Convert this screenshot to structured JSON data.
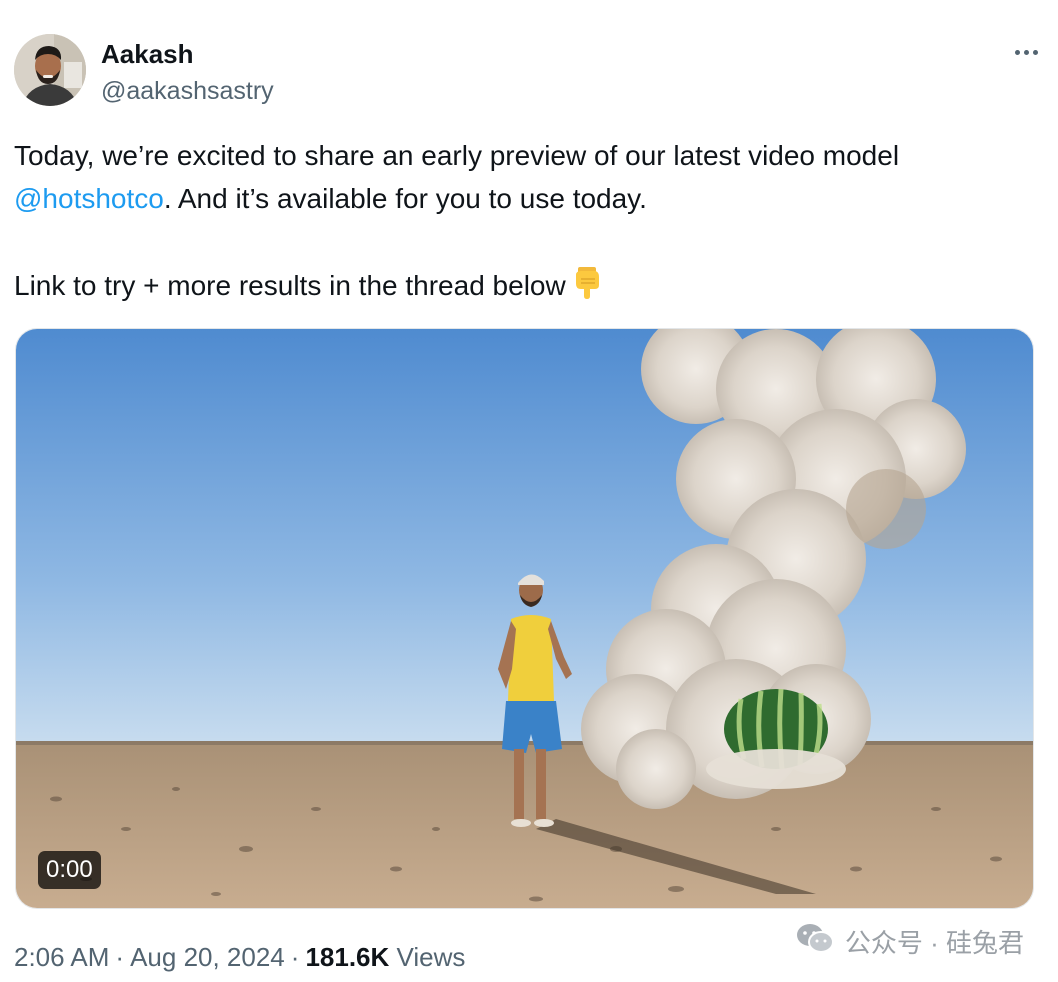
{
  "author": {
    "display_name": "Aakash",
    "handle": "@aakashsastry",
    "avatar_icon": "profile-photo"
  },
  "menu": {
    "icon": "more-horizontal-icon"
  },
  "tweet": {
    "line1": "Today, we’re excited to share an early preview of our latest video model",
    "mention": "@hotshotco",
    "line2_rest": ". And it’s available for you to use today.",
    "line3": "Link to try + more results in the thread below",
    "emoji_icon": "backhand-index-pointing-down-icon"
  },
  "video": {
    "timecode": "0:00",
    "sky_color": "#5f97d4",
    "ground_color": "#b79c80"
  },
  "meta": {
    "time": "2:06 AM",
    "separator": "·",
    "date": "Aug 20, 2024",
    "views_count": "181.6K",
    "views_label": "Views"
  },
  "watermark": {
    "icon": "wechat-icon",
    "text": "公众号 · 硅兔君"
  },
  "colors": {
    "link": "#1d9bf0",
    "secondary_text": "#536471",
    "primary_text": "#0f1419"
  }
}
